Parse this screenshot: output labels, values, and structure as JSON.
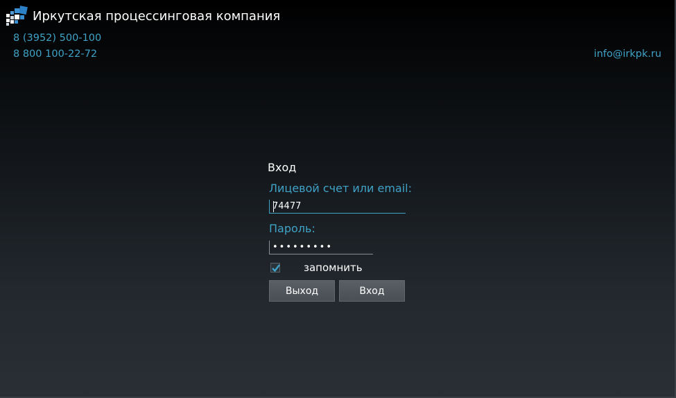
{
  "header": {
    "title": "Иркутская процессинговая компания",
    "logo_icon": "company-logo-icon"
  },
  "contacts": {
    "phone_1": "8 (3952) 500-100",
    "phone_2": "8 800 100-22-72",
    "email": "info@irkpk.ru"
  },
  "login": {
    "title": "Вход",
    "account_label": "Лицевой счет или email:",
    "account_value": "74477",
    "password_label": "Пароль:",
    "password_value": "•••••••••",
    "remember_label": "запомнить",
    "remember_checked": true,
    "exit_button": "Выход",
    "login_button": "Вход"
  },
  "colors": {
    "accent": "#3fa3c8",
    "button": "#52575d",
    "background_top": "#000000",
    "background_bottom": "#2a2f35"
  }
}
